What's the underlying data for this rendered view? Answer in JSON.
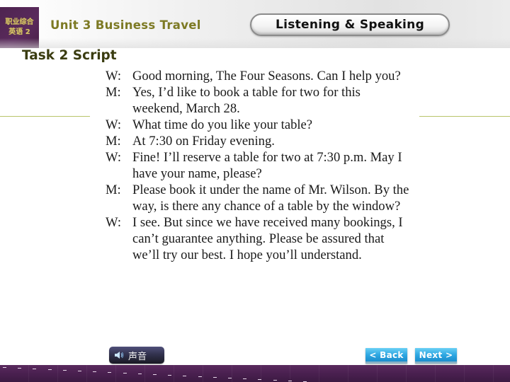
{
  "header": {
    "logo_line1": "职业综合",
    "logo_line2": "英语 2",
    "unit_title": "Unit 3 Business Travel",
    "section": "Listening & Speaking"
  },
  "task_title": "Task 2 Script",
  "script": [
    {
      "speaker": "W:",
      "text": "Good morning, The Four Seasons. Can I help you?"
    },
    {
      "speaker": "M:",
      "text": "Yes, I’d like to book a table for two for this weekend, March 28."
    },
    {
      "speaker": "W:",
      "text": "What time do you like your table?"
    },
    {
      "speaker": "M:",
      "text": "At 7:30 on Friday evening."
    },
    {
      "speaker": "W:",
      "text": "Fine! I’ll reserve a table for two at 7:30 p.m. May I have your name, please?"
    },
    {
      "speaker": "M:",
      "text": "Please book it under the name of Mr. Wilson. By the way, is there any chance of a table by the window?"
    },
    {
      "speaker": "W:",
      "text": "I see. But since we have received many bookings, I can’t guarantee anything. Please be assured that we’ll try our best. I hope you’ll understand."
    }
  ],
  "controls": {
    "sound_label": "声音",
    "sound_icon": "speaker-icon",
    "back_label": "< Back",
    "next_label": "Next >"
  },
  "colors": {
    "brand_purple": "#4e2450",
    "title_olive": "#7d7a24",
    "nav_blue": "#2fa8e2"
  }
}
